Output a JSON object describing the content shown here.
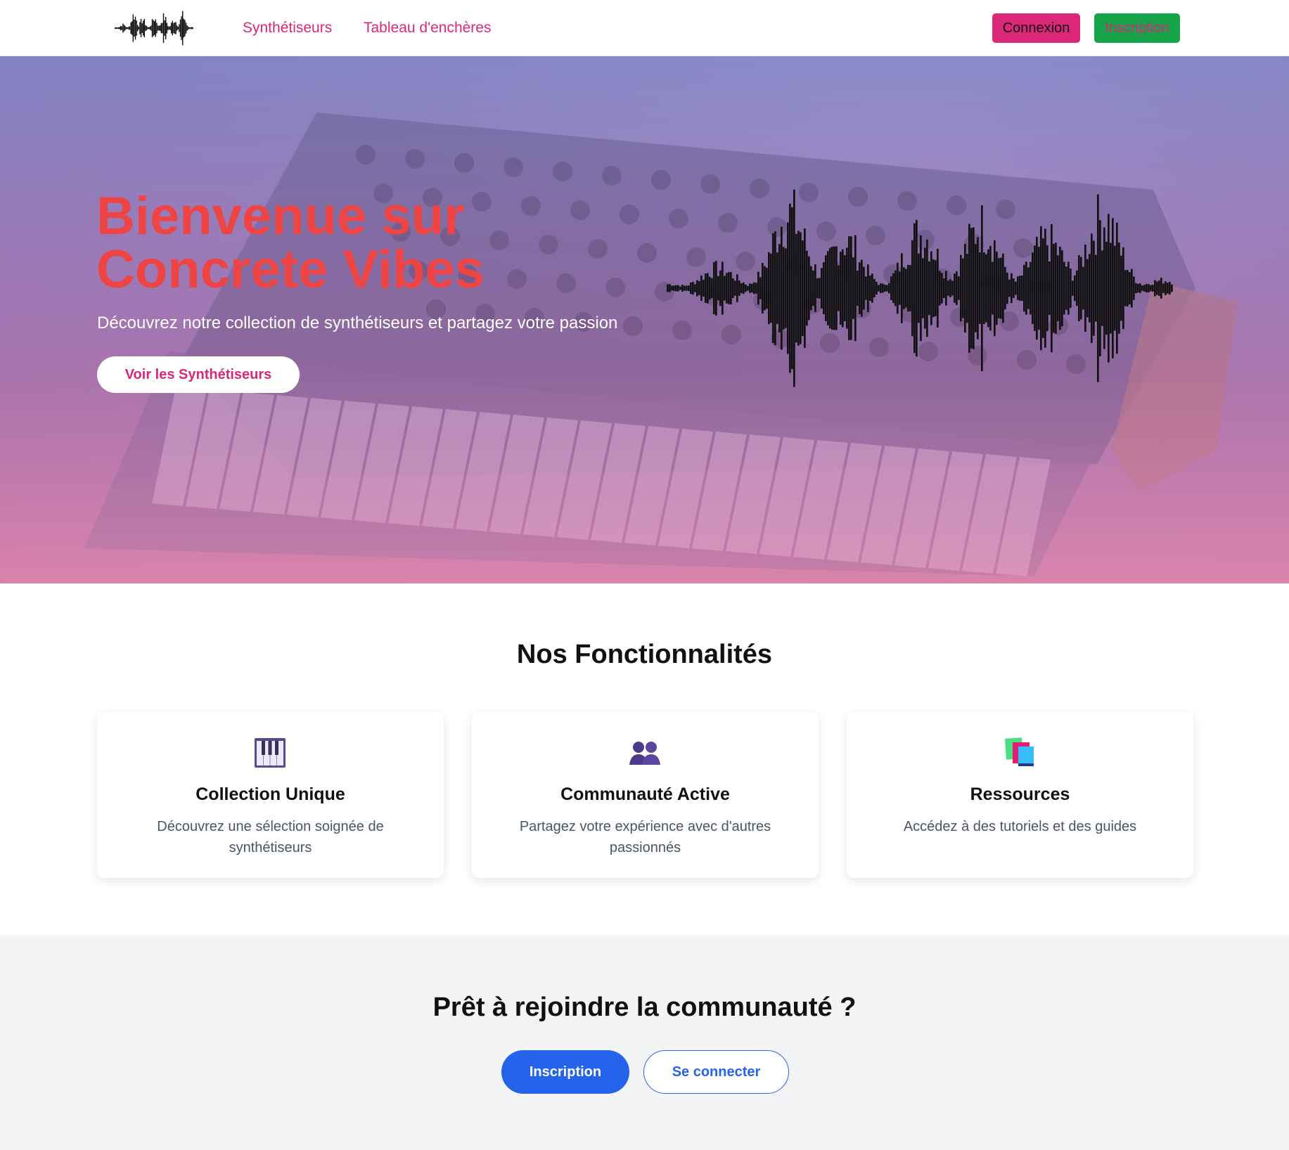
{
  "nav": {
    "logo_icon": "waveform-logo-icon",
    "links": [
      "Synthétiseurs",
      "Tableau d'enchères"
    ],
    "login_label": "Connexion",
    "signup_label": "Inscription"
  },
  "hero": {
    "title_line1": "Bienvenue sur",
    "title_line2": "Concrete Vibes",
    "subtitle": "Découvrez notre collection de synthétiseurs et partagez votre passion",
    "cta_label": "Voir les Synthétiseurs",
    "wave_icon": "waveform-graphic"
  },
  "features": {
    "title": "Nos Fonctionnalités",
    "cards": [
      {
        "icon": "piano-keys-icon",
        "title": "Collection Unique",
        "desc": "Découvrez une sélection soignée de synthétiseurs"
      },
      {
        "icon": "people-icon",
        "title": "Communauté Active",
        "desc": "Partagez votre expérience avec d'autres passionnés"
      },
      {
        "icon": "books-icon",
        "title": "Ressources",
        "desc": "Accédez à des tutoriels et des guides"
      }
    ]
  },
  "join": {
    "title": "Prêt à rejoindre la communauté ?",
    "primary_label": "Inscription",
    "secondary_label": "Se connecter"
  },
  "colors": {
    "accent_pink": "#db2777",
    "hero_title": "#ef4444",
    "signup_green": "#16a34a",
    "primary_blue": "#2563eb"
  }
}
